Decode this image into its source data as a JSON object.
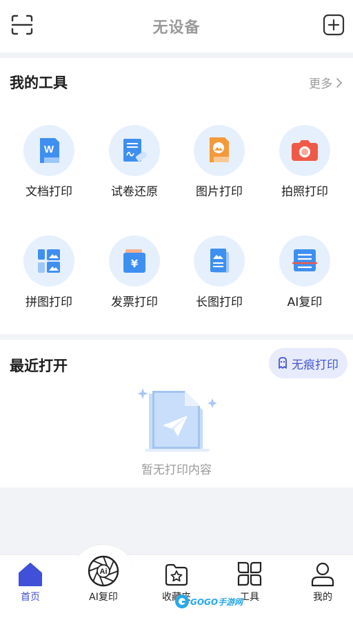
{
  "header": {
    "title": "无设备",
    "scan_icon": "scan-icon",
    "add_icon": "plus-square-icon"
  },
  "tools": {
    "title": "我的工具",
    "more_label": "更多",
    "items": [
      {
        "label": "文档打印",
        "icon": "word-doc-icon"
      },
      {
        "label": "试卷还原",
        "icon": "exam-restore-icon"
      },
      {
        "label": "图片打印",
        "icon": "image-print-icon"
      },
      {
        "label": "拍照打印",
        "icon": "camera-icon"
      },
      {
        "label": "拼图打印",
        "icon": "collage-icon"
      },
      {
        "label": "发票打印",
        "icon": "invoice-icon"
      },
      {
        "label": "长图打印",
        "icon": "long-image-icon"
      },
      {
        "label": "AI复印",
        "icon": "ai-copy-icon"
      }
    ]
  },
  "recent": {
    "title": "最近打开",
    "private_button": "无痕打印",
    "empty_text": "暂无打印内容"
  },
  "nav": {
    "items": [
      {
        "label": "首页",
        "icon": "home-icon",
        "active": true
      },
      {
        "label": "AI复印",
        "icon": "ai-aperture-icon"
      },
      {
        "label": "收藏夹",
        "icon": "favorites-folder-icon"
      },
      {
        "label": "工具",
        "icon": "tools-grid-icon"
      },
      {
        "label": "我的",
        "icon": "profile-icon"
      }
    ],
    "watermark": "GOGO手游网"
  },
  "colors": {
    "accent": "#4050d8",
    "icon_blue": "#3f8ff0",
    "icon_orange": "#f39a3b",
    "icon_red": "#ef5a48"
  }
}
